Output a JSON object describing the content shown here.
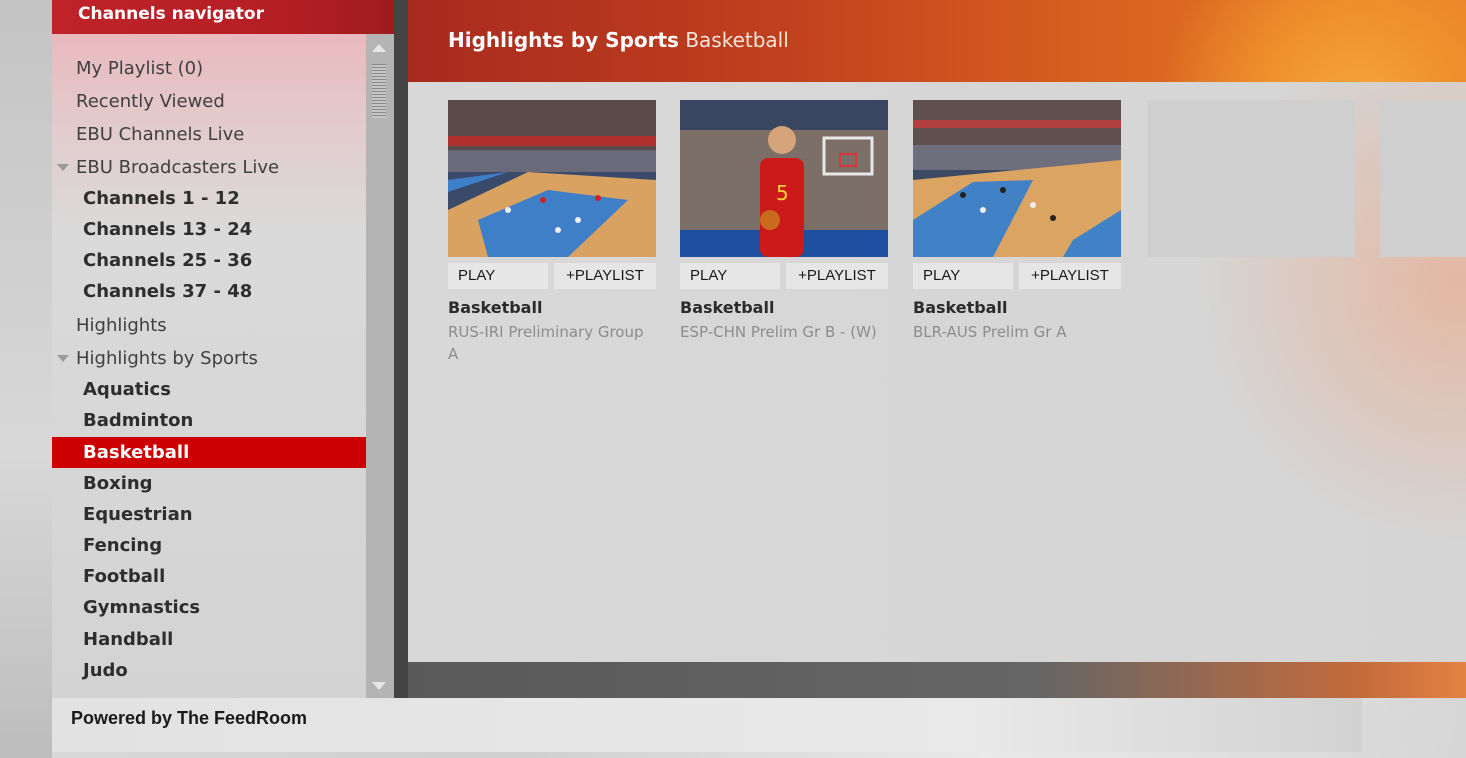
{
  "nav": {
    "header": "Channels navigator",
    "items": [
      {
        "label": "My Playlist (0)",
        "level": "top"
      },
      {
        "label": "Recently Viewed",
        "level": "top"
      },
      {
        "label": "EBU Channels Live",
        "level": "top"
      },
      {
        "label": "EBU Broadcasters Live",
        "level": "top",
        "expanded": true
      },
      {
        "label": "Channels 1 - 12",
        "level": "sub"
      },
      {
        "label": "Channels 13 - 24",
        "level": "sub"
      },
      {
        "label": "Channels 25 - 36",
        "level": "sub"
      },
      {
        "label": "Channels 37 - 48",
        "level": "sub"
      },
      {
        "label": "Highlights",
        "level": "top"
      },
      {
        "label": "Highlights by Sports",
        "level": "top",
        "expanded": true
      },
      {
        "label": "Aquatics",
        "level": "sub"
      },
      {
        "label": "Badminton",
        "level": "sub"
      },
      {
        "label": "Basketball",
        "level": "sub",
        "selected": true
      },
      {
        "label": "Boxing",
        "level": "sub"
      },
      {
        "label": "Equestrian",
        "level": "sub"
      },
      {
        "label": "Fencing",
        "level": "sub"
      },
      {
        "label": "Football",
        "level": "sub"
      },
      {
        "label": "Gymnastics",
        "level": "sub"
      },
      {
        "label": "Handball",
        "level": "sub"
      },
      {
        "label": "Judo",
        "level": "sub"
      }
    ]
  },
  "main": {
    "title_bold": "Highlights by Sports",
    "title_sub": "Basketball",
    "videos": [
      {
        "title": "Basketball",
        "desc": "RUS-IRI Preliminary Group A",
        "play": "PLAY",
        "playlist": "+PLAYLIST"
      },
      {
        "title": "Basketball",
        "desc": "ESP-CHN Prelim Gr B - (W)",
        "play": "PLAY",
        "playlist": "+PLAYLIST"
      },
      {
        "title": "Basketball",
        "desc": "BLR-AUS Prelim Gr A",
        "play": "PLAY",
        "playlist": "+PLAYLIST"
      }
    ]
  },
  "footer": {
    "powered": "Powered by The FeedRoom"
  },
  "colors": {
    "selected": "#cc0000",
    "header_red": "#b31e24",
    "header_orange": "#e8812a"
  }
}
